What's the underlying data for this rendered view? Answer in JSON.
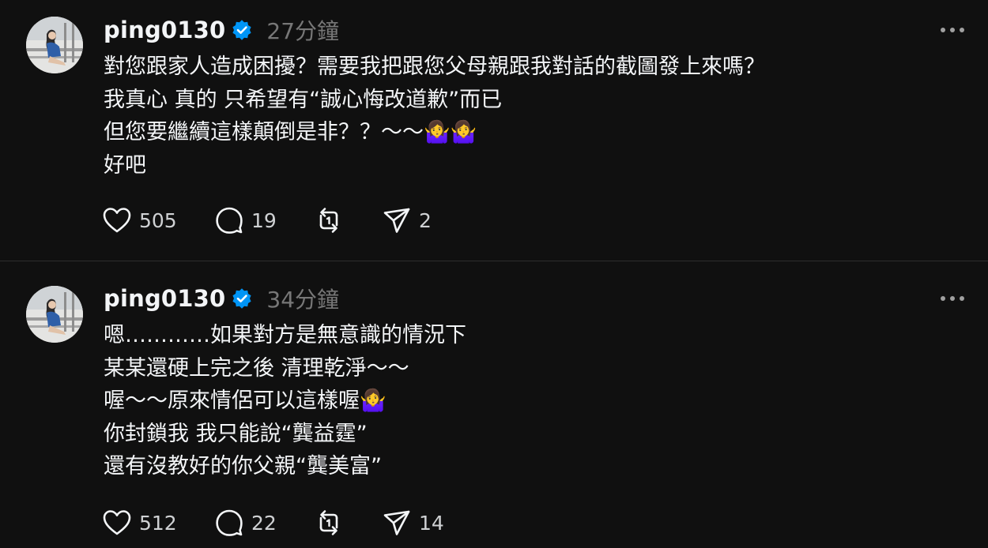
{
  "posts": [
    {
      "username": "ping0130",
      "time": "27分鐘",
      "lines": [
        "對您跟家人造成困擾？需要我把跟您父母親跟我對話的截圖發上來嗎？",
        "我真心 真的 只希望有“誠心悔改道歉”而已",
        "但您要繼續這樣顛倒是非？？～～🤷‍♀️🤷‍♀️",
        "好吧"
      ],
      "likes": "505",
      "replies": "19",
      "shares": "2"
    },
    {
      "username": "ping0130",
      "time": "34分鐘",
      "lines": [
        "嗯…………如果對方是無意識的情況下",
        "某某還硬上完之後 清理乾淨～～",
        "喔～～原來情侶可以這樣喔🤷‍♀️",
        "你封鎖我 我只能說“龔益霆”",
        "還有沒教好的你父親“龔美富”"
      ],
      "likes": "512",
      "replies": "22",
      "shares": "14"
    }
  ],
  "colors": {
    "background": "#101010",
    "text": "#f3f5f7",
    "muted": "#777777",
    "verified": "#0095f6",
    "divider": "#2e2e2e"
  },
  "icons": [
    "verified-badge-icon",
    "more-options-icon",
    "heart-icon",
    "reply-icon",
    "repost-icon",
    "share-icon"
  ]
}
